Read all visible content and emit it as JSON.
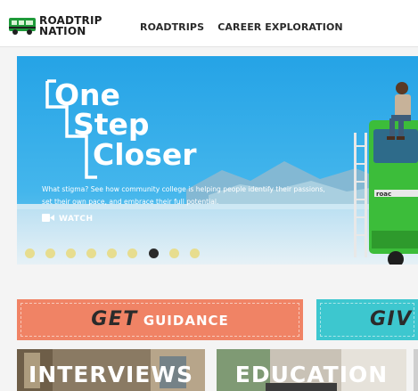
{
  "brand": {
    "line1": "ROADTRIP",
    "line2": "NATION",
    "logo": "bus-logo-icon"
  },
  "nav": {
    "roadtrips": "ROADTRIPS",
    "career_exploration": "CAREER EXPLORATION"
  },
  "hero": {
    "title_lines": [
      "One",
      "Step",
      "Closer"
    ],
    "caption": "What stigma? See how community college is helping people identify their passions, set their own pace, and embrace their full potential.",
    "watch_label": "WATCH",
    "watch_icon": "video-camera-icon",
    "bus_text": "roac",
    "slide_count": 9,
    "active_slide": 7
  },
  "banners": {
    "guidance": {
      "big": "GET",
      "small": "GUIDANCE"
    },
    "give": {
      "big": "GIV"
    }
  },
  "tiles": {
    "interviews": "INTERVIEWS",
    "education": "EDUCATION"
  },
  "colors": {
    "hero_blue": "#2aa6e6",
    "bus_green": "#3cbd3a",
    "guidance_orange": "#f08365",
    "give_teal": "#3dc7cf",
    "dot_yellow": "#e7dd8f"
  }
}
